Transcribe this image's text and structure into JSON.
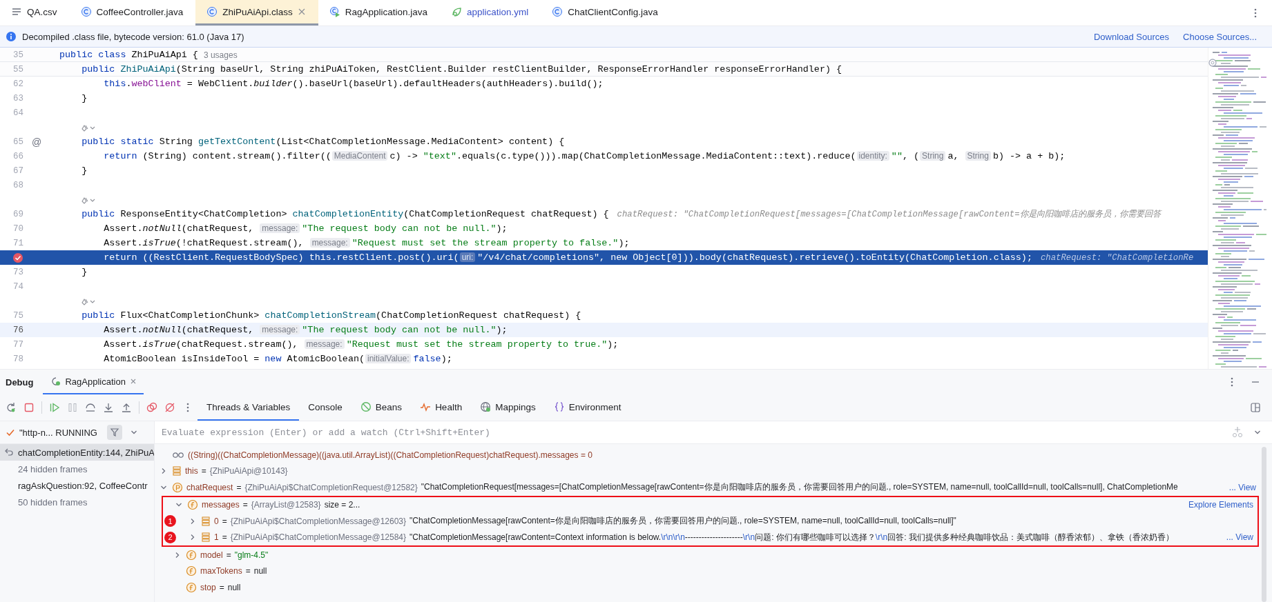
{
  "editor_tabs": [
    {
      "label": "QA.csv",
      "kind": "text",
      "selected": false,
      "modified": false
    },
    {
      "label": "CoffeeController.java",
      "kind": "class",
      "selected": false,
      "modified": false
    },
    {
      "label": "ZhiPuAiApi.class",
      "kind": "class",
      "selected": true,
      "modified": false
    },
    {
      "label": "RagApplication.java",
      "kind": "app",
      "selected": false,
      "modified": false
    },
    {
      "label": "application.yml",
      "kind": "yml",
      "selected": false,
      "modified": true
    },
    {
      "label": "ChatClientConfig.java",
      "kind": "class",
      "selected": false,
      "modified": false
    }
  ],
  "notice": {
    "text": "Decompiled .class file, bytecode version: 61.0 (Java 17)",
    "links": [
      "Download Sources",
      "Choose Sources..."
    ]
  },
  "code_lines": [
    {
      "kind": "line",
      "number": "35",
      "sticky": true,
      "breakpoint": false,
      "executing": false,
      "caret": false,
      "tokens": [
        {
          "kind": "kw",
          "text": "public class"
        },
        {
          "kind": "plain",
          "text": " ZhiPuAiApi { "
        },
        {
          "kind": "usage",
          "text": "3 usages"
        }
      ]
    },
    {
      "kind": "line",
      "number": "55",
      "sticky": true,
      "breakpoint": false,
      "executing": false,
      "caret": false,
      "tokens": [
        {
          "kind": "kw",
          "text": "    public "
        },
        {
          "kind": "fn",
          "text": "ZhiPuAiApi"
        },
        {
          "kind": "plain",
          "text": "(String baseUrl, String zhiPuAiToken, RestClient.Builder restClientBuilder, ResponseErrorHandler responseErrorHandler) {"
        }
      ]
    },
    {
      "kind": "line",
      "number": "62",
      "breakpoint": false,
      "executing": false,
      "caret": false,
      "tokens": [
        {
          "kind": "kw",
          "text": "        this"
        },
        {
          "kind": "plain",
          "text": "."
        },
        {
          "kind": "field",
          "text": "webClient"
        },
        {
          "kind": "plain",
          "text": " = WebClient."
        },
        {
          "kind": "italic",
          "text": "builder"
        },
        {
          "kind": "plain",
          "text": "().baseUrl(baseUrl).defaultHeaders(authHeaders).build();"
        }
      ]
    },
    {
      "kind": "line",
      "number": "63",
      "breakpoint": false,
      "executing": false,
      "caret": false,
      "tokens": [
        {
          "kind": "plain",
          "text": "    }"
        }
      ]
    },
    {
      "kind": "line",
      "number": "64",
      "breakpoint": false,
      "executing": false,
      "caret": false
    },
    {
      "kind": "lens"
    },
    {
      "kind": "line",
      "number": "65",
      "gutter_mark": "@",
      "breakpoint": false,
      "executing": false,
      "caret": false,
      "tokens": [
        {
          "kind": "kw",
          "text": "    public static "
        },
        {
          "kind": "plain",
          "text": "String "
        },
        {
          "kind": "fn",
          "text": "getTextContent"
        },
        {
          "kind": "plain",
          "text": "(List<ChatCompletionMessage.MediaContent> content) {"
        }
      ]
    },
    {
      "kind": "line",
      "number": "66",
      "breakpoint": false,
      "executing": false,
      "caret": false,
      "tokens": [
        {
          "kind": "kw",
          "text": "        return "
        },
        {
          "kind": "plain",
          "text": "(String) content.stream().filter(("
        },
        {
          "kind": "chip",
          "text": "MediaContent"
        },
        {
          "kind": "plain",
          "text": "c) -> "
        },
        {
          "kind": "string",
          "text": "\"text\""
        },
        {
          "kind": "plain",
          "text": ".equals(c.type())).map(ChatCompletionMessage.MediaContent::text).reduce("
        },
        {
          "kind": "chip",
          "text": "identity:"
        },
        {
          "kind": "string",
          "text": "\"\""
        },
        {
          "kind": "plain",
          "text": ", ("
        },
        {
          "kind": "chip",
          "text": "String"
        },
        {
          "kind": "plain",
          "text": "a, "
        },
        {
          "kind": "chip",
          "text": "String"
        },
        {
          "kind": "plain",
          "text": "b) -> a + b);"
        }
      ]
    },
    {
      "kind": "line",
      "number": "67",
      "breakpoint": false,
      "executing": false,
      "caret": false,
      "tokens": [
        {
          "kind": "plain",
          "text": "    }"
        }
      ]
    },
    {
      "kind": "line",
      "number": "68",
      "breakpoint": false,
      "executing": false,
      "caret": false
    },
    {
      "kind": "lens"
    },
    {
      "kind": "line",
      "number": "69",
      "breakpoint": false,
      "executing": false,
      "caret": false,
      "tokens": [
        {
          "kind": "kw",
          "text": "    public "
        },
        {
          "kind": "plain",
          "text": "ResponseEntity<ChatCompletion> "
        },
        {
          "kind": "fn",
          "text": "chatCompletionEntity"
        },
        {
          "kind": "plain",
          "text": "(ChatCompletionRequest chatRequest) {"
        }
      ],
      "inline_value": "chatRequest: \"ChatCompletionRequest[messages=[ChatCompletionMessage[rawContent=你是向阳咖啡店的服务员，你需要回答"
    },
    {
      "kind": "line",
      "number": "70",
      "breakpoint": false,
      "executing": false,
      "caret": false,
      "tokens": [
        {
          "kind": "plain",
          "text": "        Assert."
        },
        {
          "kind": "italic",
          "text": "notNull"
        },
        {
          "kind": "plain",
          "text": "(chatRequest, "
        },
        {
          "kind": "chip",
          "text": "message:"
        },
        {
          "kind": "string",
          "text": "\"The request body can not be null.\""
        },
        {
          "kind": "plain",
          "text": ");"
        }
      ]
    },
    {
      "kind": "line",
      "number": "71",
      "breakpoint": false,
      "executing": false,
      "caret": false,
      "tokens": [
        {
          "kind": "plain",
          "text": "        Assert."
        },
        {
          "kind": "italic",
          "text": "isTrue"
        },
        {
          "kind": "plain",
          "text": "(!chatRequest.stream(), "
        },
        {
          "kind": "chip",
          "text": "message:"
        },
        {
          "kind": "string",
          "text": "\"Request must set the stream property to false.\""
        },
        {
          "kind": "plain",
          "text": ");"
        }
      ]
    },
    {
      "kind": "line",
      "breakpoint": true,
      "executing": true,
      "caret": false,
      "tokens": [
        {
          "kind": "kw",
          "text": "        return "
        },
        {
          "kind": "plain",
          "text": "((RestClient.RequestBodySpec) "
        },
        {
          "kind": "kw",
          "text": "this"
        },
        {
          "kind": "plain",
          "text": "."
        },
        {
          "kind": "field",
          "text": "restClient"
        },
        {
          "kind": "plain",
          "text": ".post().uri("
        },
        {
          "kind": "chip",
          "text": "uri:"
        },
        {
          "kind": "string",
          "text": "\"/v4/chat/completions\""
        },
        {
          "kind": "plain",
          "text": ", "
        },
        {
          "kind": "kw",
          "text": "new "
        },
        {
          "kind": "plain",
          "text": "Object[0])).body(chatRequest).retrieve().toEntity(ChatCompletion."
        },
        {
          "kind": "kw",
          "text": "class"
        },
        {
          "kind": "plain",
          "text": ");"
        }
      ],
      "inline_value": "chatRequest: \"ChatCompletionRe"
    },
    {
      "kind": "line",
      "number": "73",
      "breakpoint": false,
      "executing": false,
      "caret": false,
      "tokens": [
        {
          "kind": "plain",
          "text": "    }"
        }
      ]
    },
    {
      "kind": "line",
      "number": "74",
      "breakpoint": false,
      "executing": false,
      "caret": false
    },
    {
      "kind": "lens"
    },
    {
      "kind": "line",
      "number": "75",
      "breakpoint": false,
      "executing": false,
      "caret": false,
      "tokens": [
        {
          "kind": "kw",
          "text": "    public "
        },
        {
          "kind": "plain",
          "text": "Flux<ChatCompletionChunk> "
        },
        {
          "kind": "fn",
          "text": "chatCompletionStream"
        },
        {
          "kind": "plain",
          "text": "(ChatCompletionRequest chatRequest) {"
        }
      ]
    },
    {
      "kind": "line",
      "number": "76",
      "breakpoint": false,
      "executing": false,
      "caret": true,
      "tokens": [
        {
          "kind": "plain",
          "text": "        Assert."
        },
        {
          "kind": "italic",
          "text": "notNull"
        },
        {
          "kind": "plain",
          "text": "(chatRequest, "
        },
        {
          "kind": "chip",
          "text": "message:"
        },
        {
          "kind": "string",
          "text": "\"The request body can not be null.\""
        },
        {
          "kind": "plain",
          "text": ");"
        }
      ]
    },
    {
      "kind": "line",
      "number": "77",
      "breakpoint": false,
      "executing": false,
      "caret": false,
      "tokens": [
        {
          "kind": "plain",
          "text": "        Assert."
        },
        {
          "kind": "italic",
          "text": "isTrue"
        },
        {
          "kind": "plain",
          "text": "(chatRequest.stream(), "
        },
        {
          "kind": "chip",
          "text": "message:"
        },
        {
          "kind": "string",
          "text": "\"Request must set the stream property to true.\""
        },
        {
          "kind": "plain",
          "text": ");"
        }
      ]
    },
    {
      "kind": "line",
      "number": "78",
      "breakpoint": false,
      "executing": false,
      "caret": false,
      "tokens": [
        {
          "kind": "plain",
          "text": "        AtomicBoolean isInsideTool = "
        },
        {
          "kind": "kw",
          "text": "new "
        },
        {
          "kind": "plain",
          "text": "AtomicBoolean("
        },
        {
          "kind": "chip",
          "text": "initialValue:"
        },
        {
          "kind": "kw",
          "text": "false"
        },
        {
          "kind": "plain",
          "text": ");"
        }
      ]
    }
  ],
  "debug": {
    "title": "Debug",
    "sessions": [
      {
        "label": "RagApplication",
        "selected": true
      }
    ],
    "views": [
      {
        "label": "Threads & Variables",
        "kind": "plain",
        "selected": true
      },
      {
        "label": "Console",
        "kind": "plain",
        "selected": false
      },
      {
        "label": "Beans",
        "kind": "beans",
        "selected": false
      },
      {
        "label": "Health",
        "kind": "health",
        "selected": false
      },
      {
        "label": "Mappings",
        "kind": "mappings",
        "selected": false
      },
      {
        "label": "Environment",
        "kind": "environment",
        "selected": false
      }
    ],
    "thread": {
      "label": "\"http-n... RUNNING"
    },
    "frames": [
      {
        "label": "chatCompletionEntity:144, ZhiPuA",
        "kind": "frame",
        "selected": true
      },
      {
        "label": "24 hidden frames",
        "kind": "hidden",
        "selected": false
      },
      {
        "label": "ragAskQuestion:92, CoffeeContr",
        "kind": "frame",
        "selected": false
      },
      {
        "label": "50 hidden frames",
        "kind": "hidden",
        "selected": false
      }
    ],
    "evaluate_placeholder": "Evaluate expression (Enter) or add a watch (Ctrl+Shift+Enter)",
    "variables": [
      {
        "kind": "watch",
        "text": "((String)((ChatCompletionMessage)((java.util.ArrayList)((ChatCompletionRequest)chatRequest).messages = 0"
      },
      {
        "kind": "object",
        "name": "this",
        "assign": "=",
        "type": "{ZhiPuAiApi@10143}",
        "expanded": false
      },
      {
        "kind": "param",
        "name": "chatRequest",
        "assign": "=",
        "type": "{ZhiPuAiApi$ChatCompletionRequest@12582}",
        "value": [
          {
            "kind": "plain",
            "text": "\"ChatCompletionRequest[messages=[ChatCompletionMessage[rawContent=你是向阳咖啡店的服务员，你需要回答用户的问题., role=SYSTEM, name=null, toolCallId=null, toolCalls=null], ChatCompletionMe"
          }
        ],
        "link": "... View",
        "expanded": true,
        "children": [
          {
            "kind": "field",
            "name": "messages",
            "assign": "=",
            "type": "{ArrayList@12583}",
            "note": "size = 2...",
            "link": "Explore Elements",
            "expanded": true,
            "outlined": true,
            "children": [
              {
                "kind": "element",
                "name": "0",
                "assign": "=",
                "type": "{ZhiPuAiApi$ChatCompletionMessage@12603}",
                "value": [
                  {
                    "kind": "plain",
                    "text": "\"ChatCompletionMessage[rawContent=你是向阳咖啡店的服务员，你需要回答用户的问题., role=SYSTEM, name=null, toolCallId=null, toolCalls=null]\""
                  }
                ],
                "expanded": false,
                "badge": "1"
              },
              {
                "kind": "element",
                "name": "1",
                "assign": "=",
                "type": "{ZhiPuAiApi$ChatCompletionMessage@12584}",
                "value": [
                  {
                    "kind": "plain",
                    "text": "\"ChatCompletionMessage[rawContent=Context information is below."
                  },
                  {
                    "kind": "escape",
                    "text": "\\r\\n\\r\\n"
                  },
                  {
                    "kind": "plain",
                    "text": "---------------------"
                  },
                  {
                    "kind": "escape",
                    "text": "\\r\\n"
                  },
                  {
                    "kind": "plain",
                    "text": "问题: 你们有哪些咖啡可以选择？"
                  },
                  {
                    "kind": "escape",
                    "text": "\\r\\n"
                  },
                  {
                    "kind": "plain",
                    "text": "回答: 我们提供多种经典咖啡饮品：美式咖啡（醇香浓郁）、拿铁（香浓奶香）"
                  }
                ],
                "link": "... View",
                "expanded": false,
                "badge": "2"
              }
            ]
          },
          {
            "kind": "field",
            "name": "model",
            "assign": "=",
            "value": [
              {
                "kind": "string",
                "text": "\"glm-4.5\""
              }
            ],
            "expanded": false
          },
          {
            "kind": "field",
            "name": "maxTokens",
            "assign": "=",
            "value": [
              {
                "kind": "plain",
                "text": "null"
              }
            ]
          },
          {
            "kind": "field",
            "name": "stop",
            "assign": "=",
            "value": [
              {
                "kind": "plain",
                "text": "null"
              }
            ]
          }
        ]
      }
    ]
  }
}
